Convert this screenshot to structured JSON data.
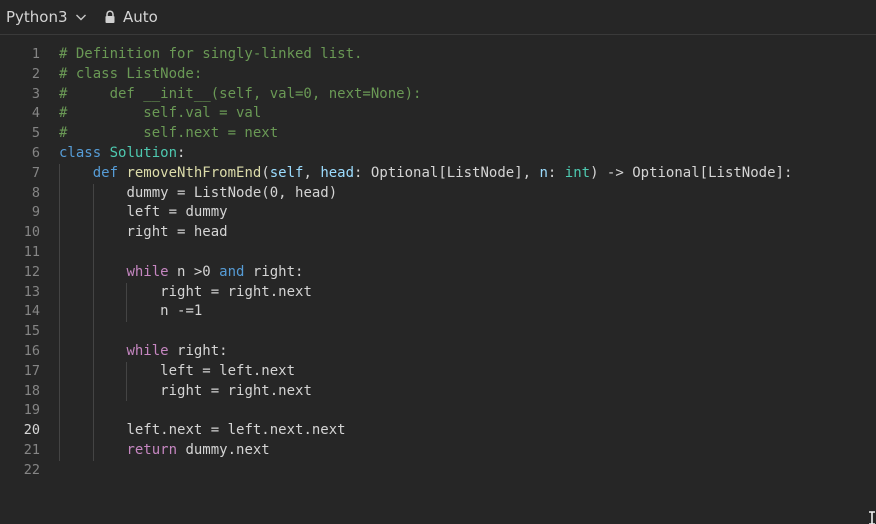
{
  "toolbar": {
    "language": "Python3",
    "mode": "Auto",
    "icons": {
      "language_dropdown": "chevron-down-icon",
      "mode": "lock-icon"
    }
  },
  "editor": {
    "active_line": 20,
    "colors": {
      "background": "#262626",
      "comment": "#6a9955",
      "keyword": "#c586c0",
      "builtin_keyword": "#569cd6",
      "class_name": "#4ec9b0",
      "function": "#dcdcaa",
      "parameter": "#9cdcfe",
      "number": "#b5cea8",
      "text": "#d4d4d4",
      "line_number": "#858585"
    },
    "lines": [
      {
        "n": "1",
        "indent": 0,
        "guides": 0,
        "tokens": [
          [
            "cm",
            "# Definition for singly-linked list."
          ]
        ]
      },
      {
        "n": "2",
        "indent": 0,
        "guides": 0,
        "tokens": [
          [
            "cm",
            "# class ListNode:"
          ]
        ]
      },
      {
        "n": "3",
        "indent": 0,
        "guides": 0,
        "tokens": [
          [
            "cm",
            "#     def __init__(self, val=0, next=None):"
          ]
        ]
      },
      {
        "n": "4",
        "indent": 0,
        "guides": 0,
        "tokens": [
          [
            "cm",
            "#         self.val = val"
          ]
        ]
      },
      {
        "n": "5",
        "indent": 0,
        "guides": 0,
        "tokens": [
          [
            "cm",
            "#         self.next = next"
          ]
        ]
      },
      {
        "n": "6",
        "indent": 0,
        "guides": 0,
        "tokens": [
          [
            "kwb",
            "class"
          ],
          [
            "",
            " "
          ],
          [
            "cls",
            "Solution"
          ],
          [
            "",
            ":"
          ]
        ]
      },
      {
        "n": "7",
        "indent": 1,
        "guides": 1,
        "tokens": [
          [
            "kwb",
            "def"
          ],
          [
            "",
            " "
          ],
          [
            "fn",
            "removeNthFromEnd"
          ],
          [
            "",
            "("
          ],
          [
            "prm",
            "self"
          ],
          [
            "",
            ", "
          ],
          [
            "prm",
            "head"
          ],
          [
            "",
            ": Optional[ListNode], "
          ],
          [
            "prm",
            "n"
          ],
          [
            "",
            ": "
          ],
          [
            "typ",
            "int"
          ],
          [
            "",
            ") -> Optional[ListNode]:"
          ]
        ]
      },
      {
        "n": "8",
        "indent": 2,
        "guides": 2,
        "tokens": [
          [
            "",
            "dummy = ListNode(0, head)"
          ]
        ]
      },
      {
        "n": "9",
        "indent": 2,
        "guides": 2,
        "tokens": [
          [
            "",
            "left = dummy"
          ]
        ]
      },
      {
        "n": "10",
        "indent": 2,
        "guides": 2,
        "tokens": [
          [
            "",
            "right = head"
          ]
        ]
      },
      {
        "n": "11",
        "indent": 0,
        "guides": 2,
        "tokens": []
      },
      {
        "n": "12",
        "indent": 2,
        "guides": 2,
        "tokens": [
          [
            "kw",
            "while"
          ],
          [
            "",
            " n >0 "
          ],
          [
            "kwb",
            "and"
          ],
          [
            "",
            " right:"
          ]
        ]
      },
      {
        "n": "13",
        "indent": 3,
        "guides": 3,
        "tokens": [
          [
            "",
            "right = right.next"
          ]
        ]
      },
      {
        "n": "14",
        "indent": 3,
        "guides": 3,
        "tokens": [
          [
            "",
            "n -=1"
          ]
        ]
      },
      {
        "n": "15",
        "indent": 0,
        "guides": 2,
        "tokens": []
      },
      {
        "n": "16",
        "indent": 2,
        "guides": 2,
        "tokens": [
          [
            "kw",
            "while"
          ],
          [
            "",
            " right:"
          ]
        ]
      },
      {
        "n": "17",
        "indent": 3,
        "guides": 3,
        "tokens": [
          [
            "",
            "left = left.next"
          ]
        ]
      },
      {
        "n": "18",
        "indent": 3,
        "guides": 3,
        "tokens": [
          [
            "",
            "right = right.next"
          ]
        ]
      },
      {
        "n": "19",
        "indent": 0,
        "guides": 2,
        "tokens": []
      },
      {
        "n": "20",
        "indent": 2,
        "guides": 2,
        "tokens": [
          [
            "",
            "left.next = left.next.next"
          ]
        ]
      },
      {
        "n": "21",
        "indent": 2,
        "guides": 2,
        "tokens": [
          [
            "kw",
            "return"
          ],
          [
            "",
            " dummy.next"
          ]
        ]
      },
      {
        "n": "22",
        "indent": 0,
        "guides": 0,
        "tokens": []
      }
    ]
  }
}
